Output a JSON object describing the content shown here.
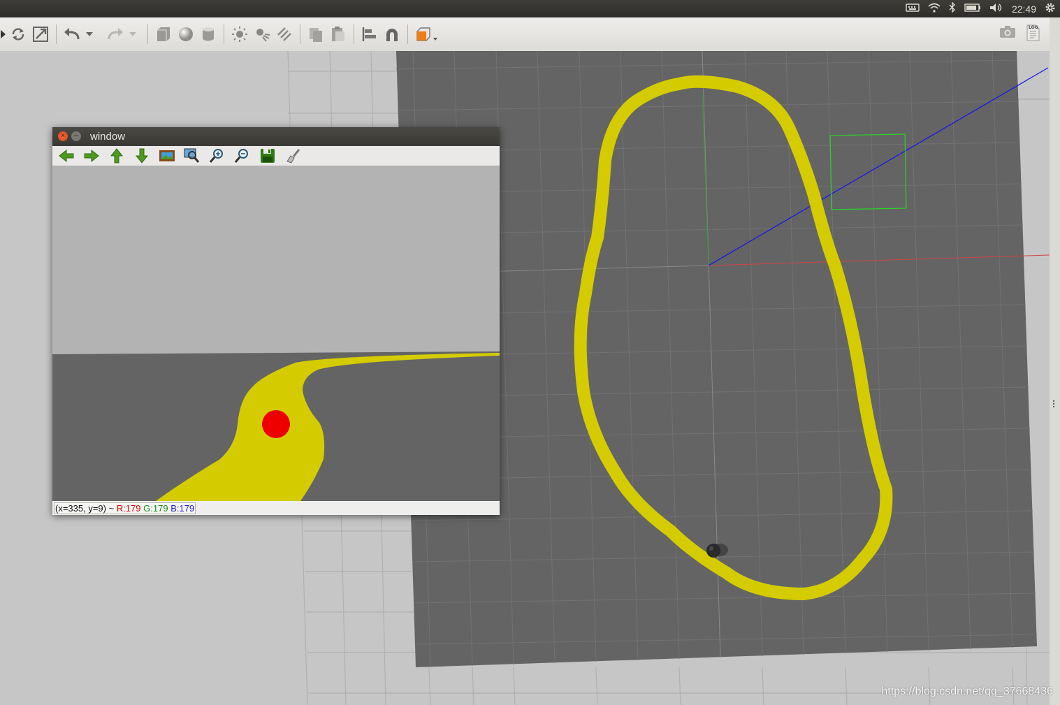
{
  "system_panel": {
    "clock": "22:49",
    "tray_icons": [
      "keyboard-icon",
      "wifi-icon",
      "bluetooth-icon",
      "battery-icon",
      "volume-icon",
      "settings-gear-icon"
    ]
  },
  "toolbar": {
    "buttons": [
      "select-mode-icon",
      "rotate-mode-icon",
      "scale-mode-icon",
      "undo-icon",
      "undo-history-icon",
      "redo-icon",
      "redo-history-icon",
      "box-shape-icon",
      "sphere-shape-icon",
      "cylinder-shape-icon",
      "point-light-icon",
      "spot-light-icon",
      "directional-light-icon",
      "copy-icon",
      "paste-icon",
      "align-icon",
      "snap-icon",
      "change-view-icon"
    ],
    "right_buttons": [
      "screenshot-icon",
      "log-icon"
    ],
    "log_label": "LOG"
  },
  "image_window": {
    "title": "window",
    "toolbar_icons": [
      "pan-left-icon",
      "pan-right-icon",
      "pan-up-icon",
      "pan-down-icon",
      "zoom-original-icon",
      "zoom-fit-icon",
      "zoom-in-icon",
      "zoom-out-icon",
      "save-icon",
      "properties-icon"
    ],
    "status": {
      "coords": "(x=335, y=9) ~",
      "r": "R:179",
      "g": "G:179",
      "b": "B:179"
    }
  },
  "colors": {
    "ground": "#646464",
    "line": "#d4cc00",
    "target_dot": "#ee0000",
    "sky": "#b3b3b3"
  },
  "watermark": "https://blog.csdn.net/qq_37668436"
}
